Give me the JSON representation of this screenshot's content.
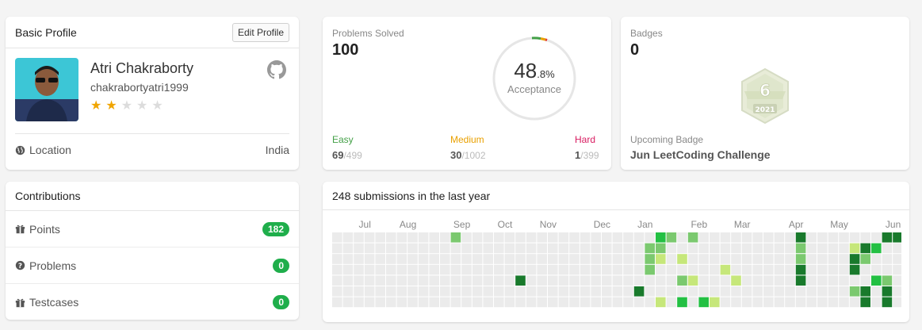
{
  "profile": {
    "title": "Basic Profile",
    "edit_label": "Edit Profile",
    "name": "Atri Chakraborty",
    "username": "chakrabortyatri1999",
    "stars_filled": 2,
    "stars_total": 5,
    "location_label": "Location",
    "location_value": "India"
  },
  "contributions": {
    "title": "Contributions",
    "rows": [
      {
        "label": "Points",
        "value": "182",
        "icon": "gift-icon"
      },
      {
        "label": "Problems",
        "value": "0",
        "icon": "question-circle-icon"
      },
      {
        "label": "Testcases",
        "value": "0",
        "icon": "gift-icon"
      }
    ]
  },
  "solved": {
    "label": "Problems Solved",
    "count": "100",
    "acceptance_int": "48",
    "acceptance_dec": ".8%",
    "acceptance_label": "Acceptance",
    "easy": {
      "label": "Easy",
      "solved": "69",
      "total": "/499",
      "color": "#43a047"
    },
    "medium": {
      "label": "Medium",
      "solved": "30",
      "total": "/1002",
      "color": "#e9a000"
    },
    "hard": {
      "label": "Hard",
      "solved": "1",
      "total": "/399",
      "color": "#d81b60"
    }
  },
  "badges": {
    "label": "Badges",
    "count": "0",
    "badge_number": "6",
    "badge_year": "2021",
    "upcoming_label": "Upcoming Badge",
    "upcoming_name": "Jun LeetCoding Challenge"
  },
  "submissions": {
    "title": "248 submissions in the last year",
    "months": [
      "Jul",
      "Aug",
      "Sep",
      "Oct",
      "Nov",
      "Dec",
      "Jan",
      "Feb",
      "Mar",
      "Apr",
      "May",
      "Jun"
    ],
    "month_weeks": [
      2,
      6,
      11,
      15,
      19,
      24,
      28,
      33,
      37,
      42,
      46,
      51
    ],
    "weeks": 53,
    "colors": {
      "0": "#ebebeb",
      "1": "#c6e77a",
      "2": "#7bc96f",
      "3": "#23c043",
      "4": "#197a2c"
    },
    "cells": [
      [
        11,
        0,
        2
      ],
      [
        30,
        0,
        3
      ],
      [
        31,
        0,
        2
      ],
      [
        33,
        0,
        2
      ],
      [
        43,
        0,
        4
      ],
      [
        51,
        0,
        4
      ],
      [
        52,
        0,
        4
      ],
      [
        29,
        1,
        2
      ],
      [
        30,
        1,
        2
      ],
      [
        43,
        1,
        2
      ],
      [
        48,
        1,
        1
      ],
      [
        49,
        1,
        4
      ],
      [
        50,
        1,
        3
      ],
      [
        29,
        2,
        2
      ],
      [
        30,
        2,
        1
      ],
      [
        32,
        2,
        1
      ],
      [
        43,
        2,
        2
      ],
      [
        48,
        2,
        4
      ],
      [
        49,
        2,
        2
      ],
      [
        29,
        3,
        2
      ],
      [
        36,
        3,
        1
      ],
      [
        43,
        3,
        4
      ],
      [
        48,
        3,
        4
      ],
      [
        17,
        4,
        4
      ],
      [
        32,
        4,
        2
      ],
      [
        33,
        4,
        1
      ],
      [
        37,
        4,
        1
      ],
      [
        43,
        4,
        4
      ],
      [
        50,
        4,
        3
      ],
      [
        51,
        4,
        2
      ],
      [
        28,
        5,
        4
      ],
      [
        48,
        5,
        2
      ],
      [
        49,
        5,
        4
      ],
      [
        51,
        5,
        4
      ],
      [
        30,
        6,
        1
      ],
      [
        32,
        6,
        3
      ],
      [
        34,
        6,
        3
      ],
      [
        35,
        6,
        1
      ],
      [
        49,
        6,
        4
      ],
      [
        51,
        6,
        4
      ]
    ]
  },
  "colors": {
    "accent": "#1fae4b",
    "star": "#f0a500"
  }
}
